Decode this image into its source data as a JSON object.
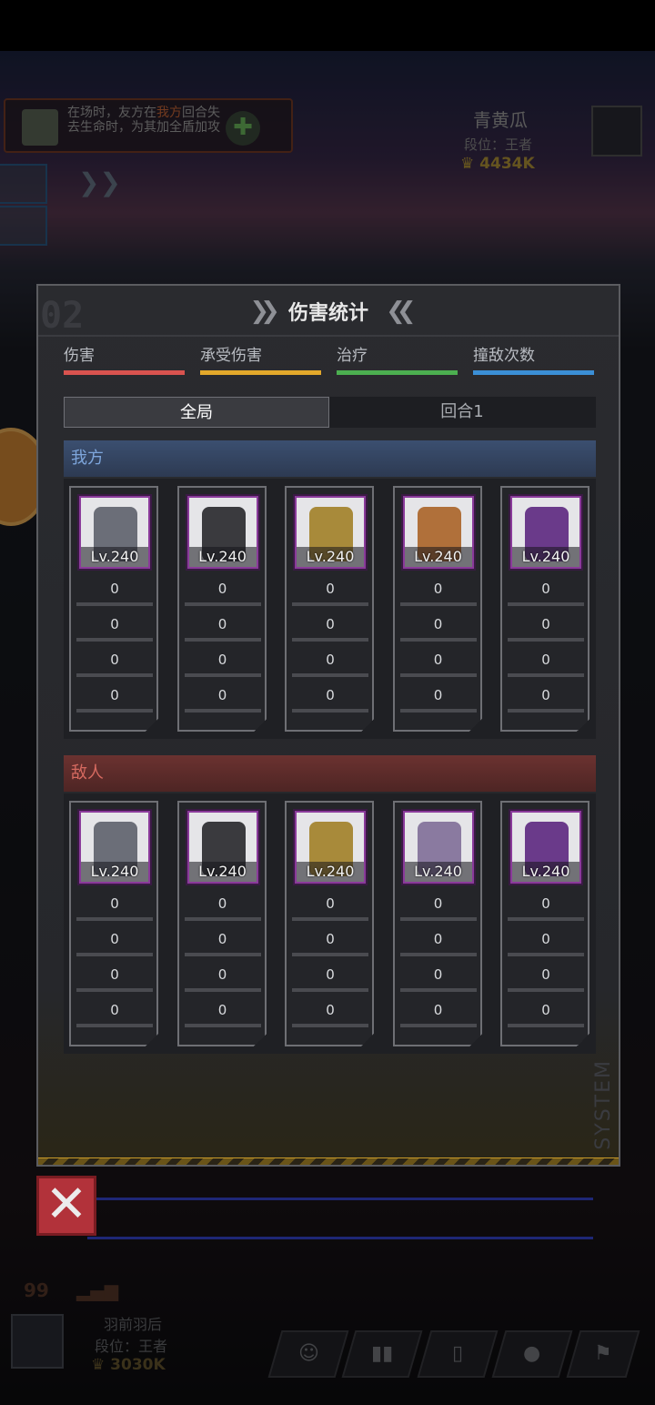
{
  "background": {
    "skill_tip": {
      "text_before": "在场时，友方在",
      "highlight": "我方",
      "text_after": "回合失去生命时，为其加全盾加攻"
    },
    "enemy_player": {
      "name": "青黄瓜",
      "rank": "段位：王者",
      "power": "4434K"
    },
    "player": {
      "name": "羽前羽后",
      "rank": "段位：王者",
      "power": "3030K"
    },
    "signal": "99"
  },
  "panel": {
    "title": "伤害统计",
    "deco_number": "02",
    "deco_system": "SYSTEM",
    "legend": [
      {
        "label": "伤害",
        "color": "#d9534f"
      },
      {
        "label": "承受伤害",
        "color": "#e3a82b"
      },
      {
        "label": "治疗",
        "color": "#4caf50"
      },
      {
        "label": "撞敌次数",
        "color": "#3b8fd6"
      }
    ],
    "tabs": [
      {
        "label": "全局",
        "active": true
      },
      {
        "label": "回合1",
        "active": false
      }
    ],
    "ally": {
      "label": "我方",
      "units": [
        {
          "level": "Lv.240",
          "portrait": "hooded-girl-portrait",
          "stats": [
            "0",
            "0",
            "0",
            "0"
          ]
        },
        {
          "level": "Lv.240",
          "portrait": "horned-girl-portrait",
          "stats": [
            "0",
            "0",
            "0",
            "0"
          ]
        },
        {
          "level": "Lv.240",
          "portrait": "masked-soldier-portrait",
          "stats": [
            "0",
            "0",
            "0",
            "0"
          ]
        },
        {
          "level": "Lv.240",
          "portrait": "bandana-girl-portrait",
          "stats": [
            "0",
            "0",
            "0",
            "0"
          ]
        },
        {
          "level": "Lv.240",
          "portrait": "purple-dragon-portrait",
          "stats": [
            "0",
            "0",
            "0",
            "0"
          ]
        }
      ]
    },
    "enemy": {
      "label": "敌人",
      "units": [
        {
          "level": "Lv.240",
          "portrait": "hooded-girl-portrait",
          "stats": [
            "0",
            "0",
            "0",
            "0"
          ]
        },
        {
          "level": "Lv.240",
          "portrait": "horned-girl-portrait",
          "stats": [
            "0",
            "0",
            "0",
            "0"
          ]
        },
        {
          "level": "Lv.240",
          "portrait": "masked-soldier-portrait",
          "stats": [
            "0",
            "0",
            "0",
            "0"
          ]
        },
        {
          "level": "Lv.240",
          "portrait": "silver-hair-girl-portrait",
          "stats": [
            "0",
            "0",
            "0",
            "0"
          ]
        },
        {
          "level": "Lv.240",
          "portrait": "purple-dragon-portrait",
          "stats": [
            "0",
            "0",
            "0",
            "0"
          ]
        }
      ]
    }
  },
  "close_icon": "close-icon",
  "dock_icons": [
    "team-icon",
    "stats-icon",
    "item-icon",
    "emote-icon",
    "flag-icon"
  ]
}
